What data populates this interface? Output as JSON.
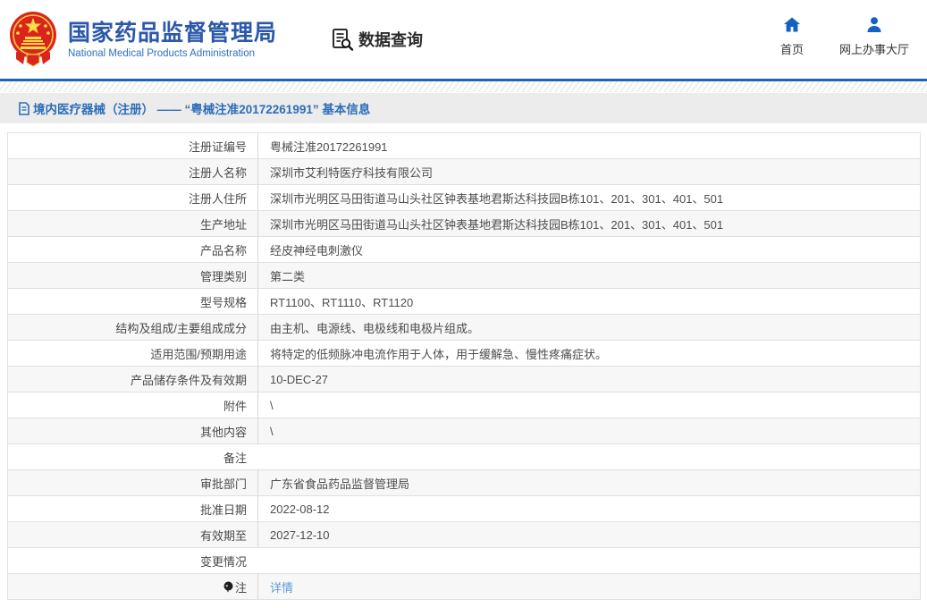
{
  "header": {
    "title_cn": "国家药品监督管理局",
    "title_en": "National Medical Products Administration",
    "section_label": "数据查询",
    "nav": [
      {
        "label": "首页",
        "icon": "home-icon"
      },
      {
        "label": "网上办事大厅",
        "icon": "user-icon"
      }
    ],
    "colors": {
      "brand_blue": "#2b58a8",
      "icon_blue": "#1660bf",
      "line_blue": "#1f66b1"
    }
  },
  "breadcrumb": {
    "text": "境内医疗器械（注册） —— “粤械注准20172261991” 基本信息",
    "icon": "document-icon",
    "color": "#2d6db8"
  },
  "table": {
    "link_color": "#5b9bd5",
    "rows": [
      {
        "label": "注册证编号",
        "value": "粤械注准20172261991"
      },
      {
        "label": "注册人名称",
        "value": "深圳市艾利特医疗科技有限公司"
      },
      {
        "label": "注册人住所",
        "value": "深圳市光明区马田街道马山头社区钟表基地君斯达科技园B栋101、201、301、401、501"
      },
      {
        "label": "生产地址",
        "value": "深圳市光明区马田街道马山头社区钟表基地君斯达科技园B栋101、201、301、401、501"
      },
      {
        "label": "产品名称",
        "value": "经皮神经电刺激仪"
      },
      {
        "label": "管理类别",
        "value": "第二类"
      },
      {
        "label": "型号规格",
        "value": "RT1100、RT1110、RT1120"
      },
      {
        "label": "结构及组成/主要组成成分",
        "value": "由主机、电源线、电极线和电极片组成。"
      },
      {
        "label": "适用范围/预期用途",
        "value": "将特定的低频脉冲电流作用于人体，用于缓解急、慢性疼痛症状。"
      },
      {
        "label": "产品储存条件及有效期",
        "value": "10-DEC-27"
      },
      {
        "label": "附件",
        "value": "\\"
      },
      {
        "label": "其他内容",
        "value": "\\"
      },
      {
        "label": "备注",
        "value": ""
      },
      {
        "label": "审批部门",
        "value": "广东省食品药品监督管理局"
      },
      {
        "label": "批准日期",
        "value": "2022-08-12"
      },
      {
        "label": "有效期至",
        "value": "2027-12-10"
      },
      {
        "label": "变更情况",
        "value": ""
      },
      {
        "label": "注",
        "value": "详情",
        "icon": "bulb-icon",
        "value_is_link": true
      }
    ]
  }
}
